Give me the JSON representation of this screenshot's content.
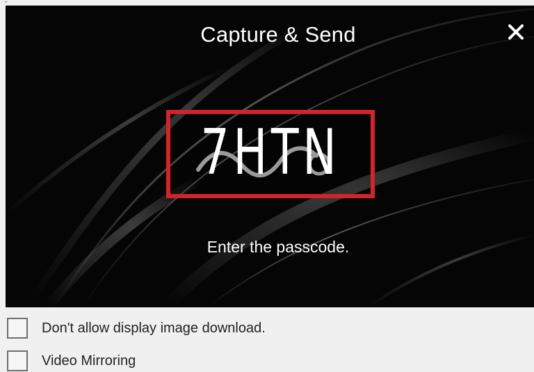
{
  "dialog": {
    "title": "Capture & Send",
    "close_icon": "close-icon",
    "passcode": "7HTN",
    "prompt": "Enter the passcode."
  },
  "options": [
    {
      "label": "Don't allow display image download.",
      "checked": false
    },
    {
      "label": "Video Mirroring",
      "checked": false
    }
  ],
  "colors": {
    "panel_background": "#050505",
    "passcode_border": "#d3232b",
    "text": "#ffffff",
    "page_background": "#f0f0f0"
  }
}
